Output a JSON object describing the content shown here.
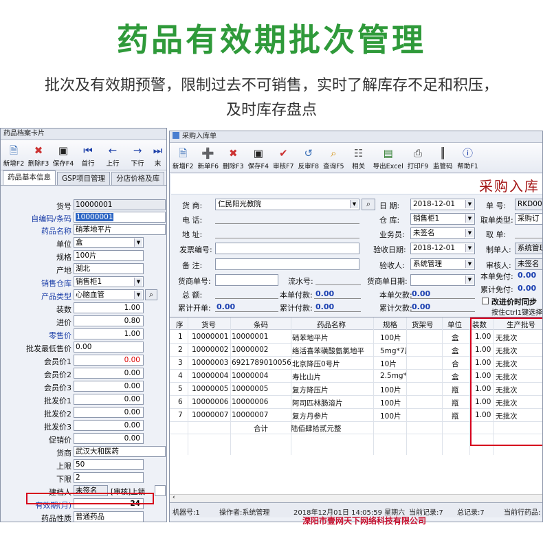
{
  "hero": {
    "title": "药品有效期批次管理",
    "line1": "批次及有效期预警，限制过去不可销售，实时了解库存不足和积压，",
    "line2": "及时库存盘点"
  },
  "left_window": {
    "title": "药品档案卡片",
    "toolbar": [
      {
        "label": "新增F2",
        "icon": "new-doc-icon"
      },
      {
        "label": "删除F3",
        "icon": "delete-doc-icon"
      },
      {
        "label": "保存F4",
        "icon": "floppy-icon"
      },
      {
        "label": "首行",
        "icon": "first-row-icon"
      },
      {
        "label": "上行",
        "icon": "prev-row-icon"
      },
      {
        "label": "下行",
        "icon": "next-row-icon"
      },
      {
        "label": "末",
        "icon": "last-row-icon"
      }
    ],
    "tabs": [
      "药品基本信息",
      "GSP项目管理",
      "分店价格及库"
    ],
    "fields": [
      {
        "label": "货号",
        "value": "10000001"
      },
      {
        "label": "自编码/条码",
        "value": "10000001"
      },
      {
        "label": "药品名称",
        "value": "硝苯地平片"
      },
      {
        "label": "单位",
        "value": "盒"
      },
      {
        "label": "规格",
        "value": "100片"
      },
      {
        "label": "产地",
        "value": "湖北"
      },
      {
        "label": "销售仓库",
        "value": "销售柜1"
      },
      {
        "label": "产品类型",
        "value": "心脑血管"
      },
      {
        "label": "装数",
        "value": "1.00"
      },
      {
        "label": "进价",
        "value": "0.80"
      },
      {
        "label": "零售价",
        "value": "1.00"
      },
      {
        "label": "批发最低售价",
        "value": "0.00"
      },
      {
        "label": "会员价1",
        "value": "0.00"
      },
      {
        "label": "会员价2",
        "value": "0.00"
      },
      {
        "label": "会员价3",
        "value": "0.00"
      },
      {
        "label": "批发价1",
        "value": "0.00"
      },
      {
        "label": "批发价2",
        "value": "0.00"
      },
      {
        "label": "批发价3",
        "value": "0.00"
      },
      {
        "label": "促销价",
        "value": "0.00"
      },
      {
        "label": "货商",
        "value": "武汉大和医药"
      },
      {
        "label": "上限",
        "value": "50"
      },
      {
        "label": "下限",
        "value": "2"
      },
      {
        "label": "建档人",
        "value": "未签名"
      },
      {
        "label": "有效期(月)",
        "value": "24"
      },
      {
        "label": "药品性质",
        "value": "普通药品"
      }
    ],
    "audit_label": "[审核]上锁"
  },
  "right_window": {
    "title": "采购入库单",
    "toolbar": [
      {
        "label": "新增F2",
        "icon": "new-doc-icon"
      },
      {
        "label": "新单F6",
        "icon": "new-order-icon"
      },
      {
        "label": "删除F3",
        "icon": "delete-doc-icon"
      },
      {
        "label": "保存F4",
        "icon": "floppy-icon"
      },
      {
        "label": "审核F7",
        "icon": "approve-icon"
      },
      {
        "label": "反审F8",
        "icon": "unapprove-icon"
      },
      {
        "label": "查询F5",
        "icon": "magnifier-icon"
      },
      {
        "label": "相关",
        "icon": "related-icon"
      },
      {
        "label": "导出Excel",
        "icon": "export-excel-icon"
      },
      {
        "label": "打印F9",
        "icon": "printer-icon"
      },
      {
        "label": "监管码",
        "icon": "barcode-icon"
      },
      {
        "label": "帮助F1",
        "icon": "help-icon"
      }
    ],
    "heading": "采购入库",
    "form": {
      "supplier_label": "货    商:",
      "supplier": "仁民阳光教院",
      "phone_label": "电    话:",
      "address_label": "地    址:",
      "invoice_label": "发票编号:",
      "note_label": "备    注:",
      "date_label": "日  期:",
      "date": "2018-12-01",
      "warehouse_label": "仓  库:",
      "warehouse": "销售柜1",
      "salesman_label": "业务员:",
      "salesman": "未签名",
      "recv_date_label": "验收日期:",
      "recv_date": "2018-12-01",
      "receiver_label": "验收人:",
      "receiver": "系统管理",
      "order_no_label": "单  号:",
      "order_no": "RKD0011",
      "fetch_type_label": "取单类型:",
      "fetch_type": "采购订",
      "fetch_no_label": "取  单:",
      "maker_label": "制单人:",
      "maker": "系统管理",
      "reviewer_label": "审核人:",
      "reviewer": "未签名",
      "merchant_no_label": "货商单号:",
      "flow_no_label": "流水号:",
      "merchant_date_label": "货商单日期:",
      "total_label": "总    额:",
      "paid_label": "本单付款:",
      "paid": "0.00",
      "owed_label": "本单欠款:",
      "owed": "0.00",
      "free_label": "本单免付:",
      "free": "0.00",
      "total_orders_label": "累计开单:",
      "total_orders": "0.00",
      "total_paid_label": "累计付款:",
      "total_paid": "0.00",
      "total_owed_label": "累计欠款:",
      "total_owed": "0.00",
      "total_free_label": "累计免付:",
      "total_free": "0.00",
      "sync_label": "改进价时同步",
      "ctrl_hint": "按住Ctrl1键选择"
    },
    "columns": [
      "序",
      "货号",
      "条码",
      "药品名称",
      "规格",
      "货架号",
      "单位",
      "装数",
      "生产批号"
    ],
    "rows": [
      [
        "1",
        "10000001",
        "10000001",
        "硝苯地平片",
        "100片",
        "",
        "盒",
        "1.00",
        "无批次"
      ],
      [
        "2",
        "10000002",
        "10000002",
        "络活喜苯磺酸氨氯地平",
        "5mg*7片",
        "",
        "盒",
        "1.00",
        "无批次"
      ],
      [
        "3",
        "10000003",
        "6921789010056",
        "北京降压0号片",
        "10片",
        "",
        "合",
        "1.00",
        "无批次"
      ],
      [
        "4",
        "10000004",
        "10000004",
        "寿比山片",
        "2.5mg*3",
        "",
        "盒",
        "1.00",
        "无批次"
      ],
      [
        "5",
        "10000005",
        "10000005",
        "复方降压片",
        "100片",
        "",
        "瓶",
        "1.00",
        "无批次"
      ],
      [
        "6",
        "10000006",
        "10000006",
        "阿司匹林肠溶片",
        "100片",
        "",
        "瓶",
        "1.00",
        "无批次"
      ],
      [
        "7",
        "10000007",
        "10000007",
        "复方丹参片",
        "100片",
        "",
        "瓶",
        "1.00",
        "无批次"
      ]
    ],
    "total_row": {
      "label": "合计",
      "amount": "陆佰肆拾贰元整"
    },
    "status": {
      "machine": "机器号:1",
      "operator": "操作者:系统管理",
      "datetime": "2018年12月01日 14:05:59 星期六",
      "current_record": "当前记录:7",
      "total_records": "总记录:7",
      "current_item": "当前行药品:"
    }
  },
  "watermark": "溧阳市壹网天下网络科技有限公司",
  "colors": {
    "brand_green": "#2f9a3a",
    "highlight_red": "#d6001c",
    "title_red": "#a31515",
    "label_blue": "#1c3fa8"
  }
}
